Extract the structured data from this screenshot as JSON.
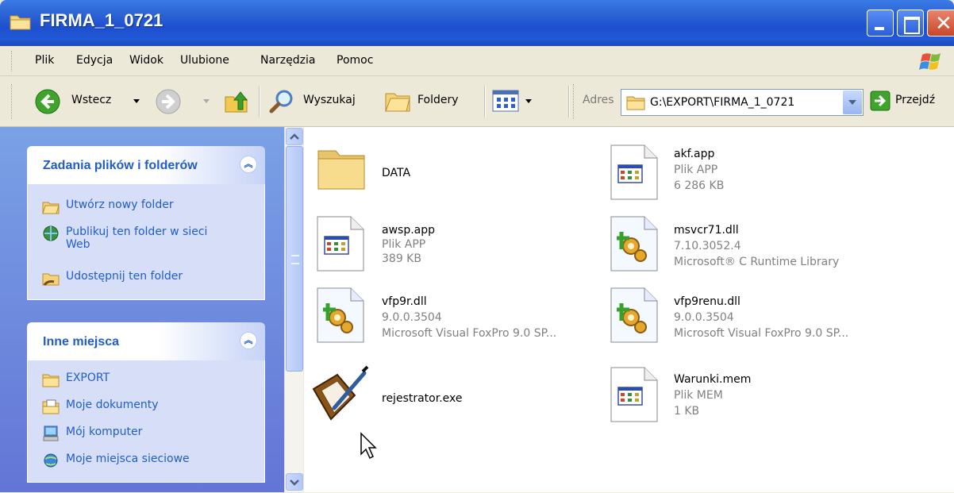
{
  "window": {
    "title": "FIRMA_1_0721"
  },
  "menu": [
    "Plik",
    "Edycja",
    "Widok",
    "Ulubione",
    "Narzędzia",
    "Pomoc"
  ],
  "toolbar": {
    "back_label": "Wstecz",
    "search_label": "Wyszukaj",
    "folders_label": "Foldery",
    "address_label": "Adres",
    "address_value": "G:\\EXPORT\\FIRMA_1_0721",
    "go_label": "Przejdź"
  },
  "tasks_panel": {
    "title": "Zadania plików i folderów",
    "items": [
      {
        "label": "Utwórz nowy folder",
        "icon": "new-folder-icon"
      },
      {
        "label": "Publikuj ten folder w sieci Web",
        "icon": "publish-web-icon"
      },
      {
        "label": "Udostępnij ten folder",
        "icon": "share-folder-icon"
      }
    ]
  },
  "places_panel": {
    "title": "Inne miejsca",
    "items": [
      {
        "label": "EXPORT",
        "icon": "folder-icon"
      },
      {
        "label": "Moje dokumenty",
        "icon": "my-documents-icon"
      },
      {
        "label": "Mój komputer",
        "icon": "my-computer-icon"
      },
      {
        "label": "Moje miejsca sieciowe",
        "icon": "network-places-icon"
      }
    ]
  },
  "files": [
    {
      "name": "DATA",
      "type": "",
      "detail": "",
      "icon": "folder-icon"
    },
    {
      "name": "akf.app",
      "type": "Plik APP",
      "detail": "6 286 KB",
      "icon": "app-file-icon"
    },
    {
      "name": "awsp.app",
      "type": "Plik APP",
      "detail": "389 KB",
      "icon": "app-file-icon"
    },
    {
      "name": "msvcr71.dll",
      "type": "7.10.3052.4",
      "detail": "Microsoft® C Runtime Library",
      "icon": "dll-file-icon"
    },
    {
      "name": "vfp9r.dll",
      "type": "9.0.0.3504",
      "detail": "Microsoft Visual FoxPro 9.0 SP...",
      "icon": "dll-file-icon"
    },
    {
      "name": "vfp9renu.dll",
      "type": "9.0.0.3504",
      "detail": "Microsoft Visual FoxPro 9.0 SP...",
      "icon": "dll-file-icon"
    },
    {
      "name": "rejestrator.exe",
      "type": "",
      "detail": "",
      "icon": "exe-book-icon"
    },
    {
      "name": "Warunki.mem",
      "type": "Plik MEM",
      "detail": "1 KB",
      "icon": "mem-file-icon"
    }
  ],
  "colors": {
    "title_bar": "#1d4fcf",
    "task_link": "#215dc6",
    "left_pane": "#7aa1e6"
  }
}
